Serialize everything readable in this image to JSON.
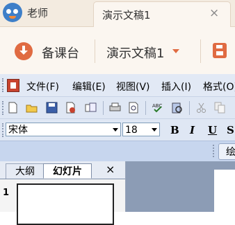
{
  "tabbar": {
    "user_name": "老师",
    "doc_tab_title": "演示文稿1",
    "close_symbol": "×"
  },
  "bar2": {
    "prepare_label": "备课台",
    "doc_selector": "演示文稿1"
  },
  "menubar": {
    "items": [
      "文件(F)",
      "编辑(E)",
      "视图(V)",
      "插入(I)",
      "格式(O)"
    ]
  },
  "toolbar": {
    "icons": [
      "new-icon",
      "open-icon",
      "save-icon",
      "permission-icon",
      "email-icon",
      "print-icon",
      "print-preview-icon",
      "spelling-icon",
      "research-icon",
      "cut-icon",
      "copy-icon"
    ]
  },
  "formatbar": {
    "font_name": "宋体",
    "font_size": "18",
    "bold": "B",
    "italic": "I",
    "underline": "U",
    "shadow": "S"
  },
  "drawbar": {
    "draw_label": "绘"
  },
  "outline_pane": {
    "tab_outline": "大纲",
    "tab_slides": "幻灯片",
    "close_symbol": "×",
    "slide_number": "1"
  },
  "colors": {
    "accent": "#e06b42",
    "office_bar": "#dfe7f4"
  }
}
